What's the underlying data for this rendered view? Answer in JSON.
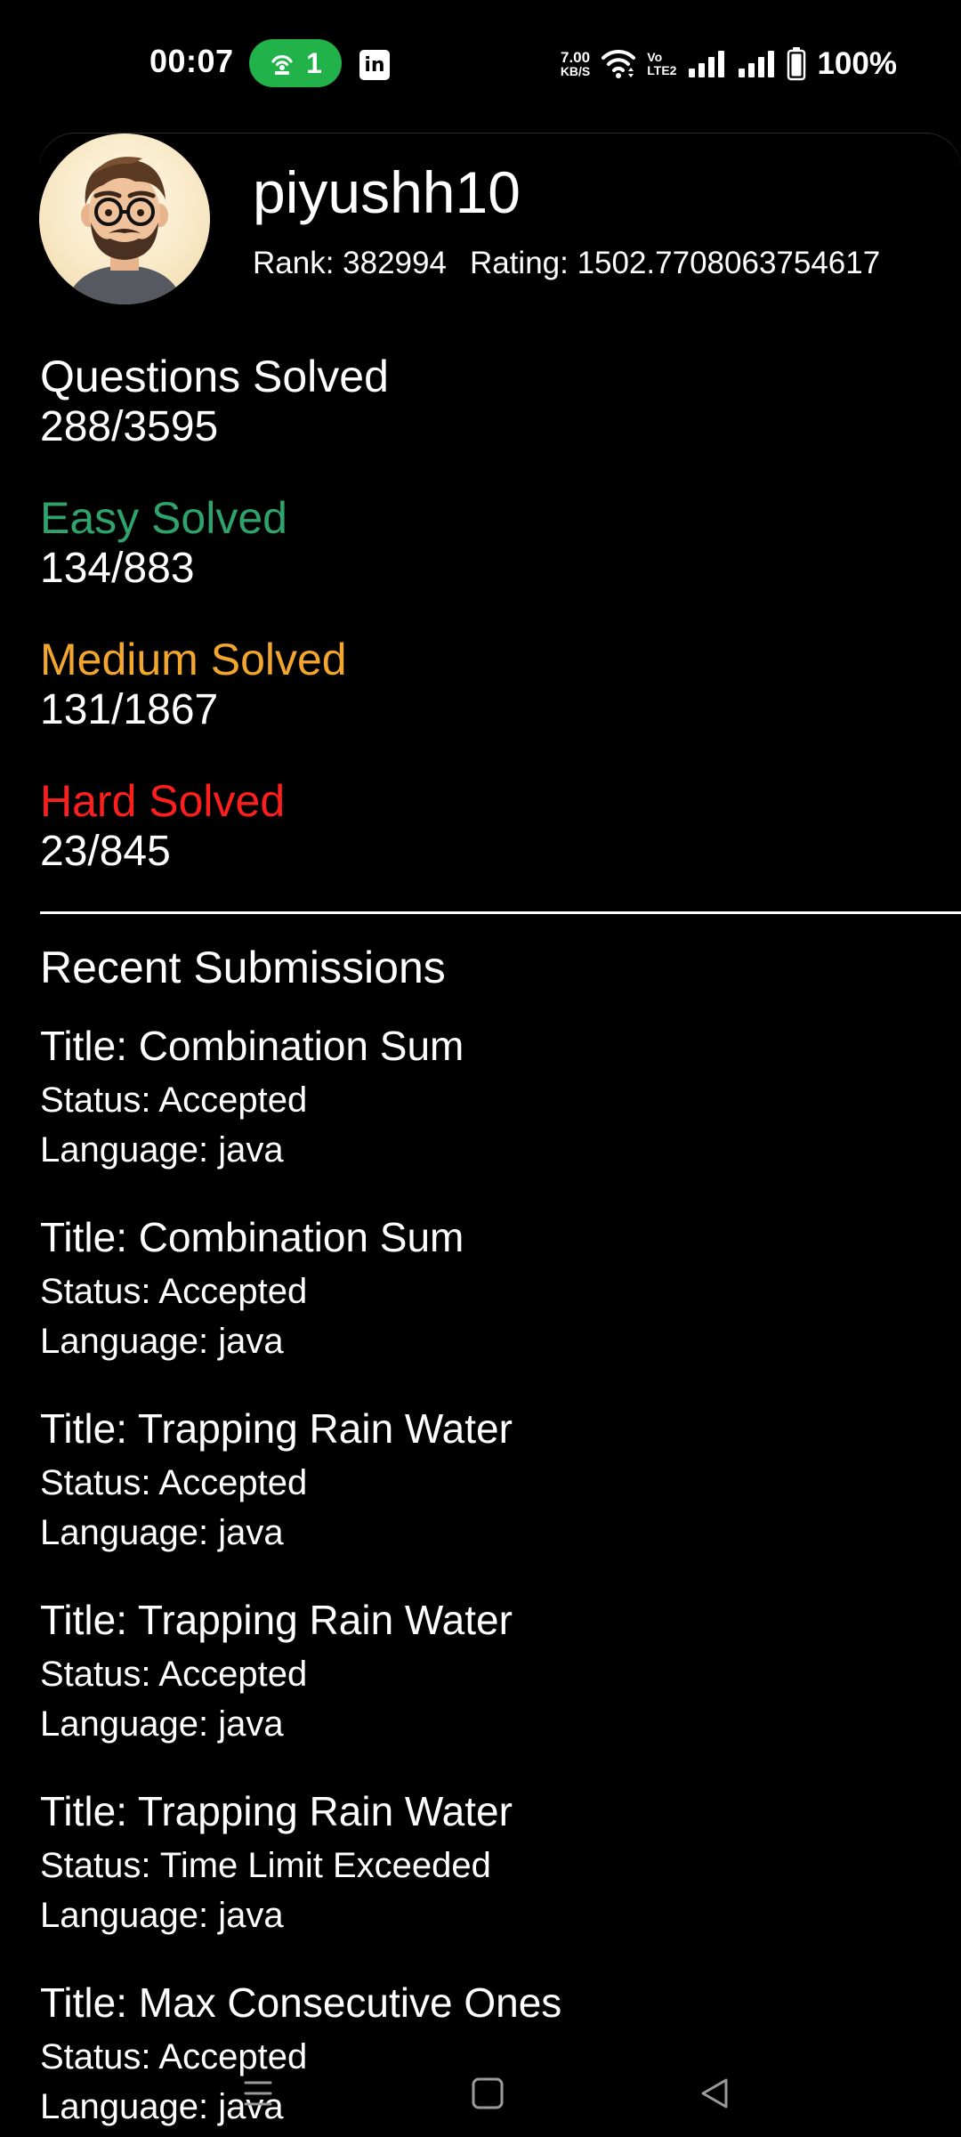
{
  "status_bar": {
    "time": "00:07",
    "hotspot_count": "1",
    "linkedin_label": "in",
    "net_speed": "7.00",
    "net_unit": "KB/S",
    "volte_top": "Vo",
    "volte_bottom": "LTE2",
    "battery": "100%",
    "icons": [
      "hotspot-icon",
      "linkedin-icon",
      "wifi-icon",
      "volte-icon",
      "signal-icon",
      "signal-icon",
      "battery-icon"
    ]
  },
  "profile": {
    "username": "piyushh10",
    "rank": "Rank: 382994",
    "rating": "Rating: 1502.7708063754617"
  },
  "stats": {
    "questions_label": "Questions Solved",
    "questions_value": "288/3595",
    "easy_label": "Easy Solved",
    "easy_value": "134/883",
    "medium_label": "Medium Solved",
    "medium_value": "131/1867",
    "hard_label": "Hard Solved",
    "hard_value": "23/845",
    "colors": {
      "easy": "#2ea36b",
      "medium": "#f3a62e",
      "hard": "#ff1e1e"
    }
  },
  "recent": {
    "heading": "Recent Submissions",
    "submissions": [
      {
        "title": "Title: Combination Sum",
        "status": "Status: Accepted",
        "language": "Language: java"
      },
      {
        "title": "Title: Combination Sum",
        "status": "Status: Accepted",
        "language": "Language: java"
      },
      {
        "title": "Title: Trapping Rain Water",
        "status": "Status: Accepted",
        "language": "Language: java"
      },
      {
        "title": "Title: Trapping Rain Water",
        "status": "Status: Accepted",
        "language": "Language: java"
      },
      {
        "title": "Title: Trapping Rain Water",
        "status": "Status: Time Limit Exceeded",
        "language": "Language: java"
      },
      {
        "title": "Title: Max Consecutive Ones",
        "status": "Status: Accepted",
        "language": "Language: java"
      }
    ]
  },
  "nav_bar": {
    "icons": [
      "recents-icon",
      "home-icon",
      "back-icon"
    ]
  }
}
